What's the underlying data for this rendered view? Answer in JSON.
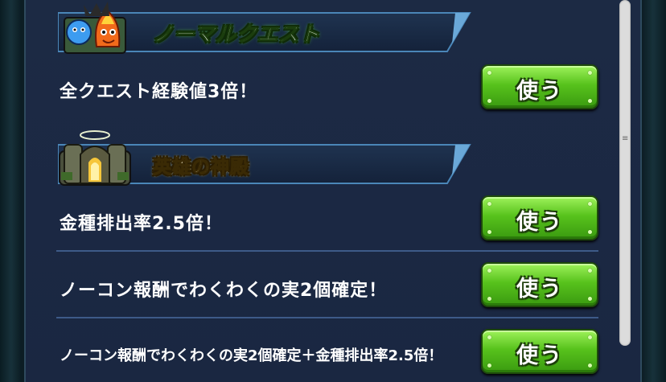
{
  "sections": [
    {
      "title": "ノーマルクエスト",
      "icon": "quest-monsters-icon",
      "rows": [
        {
          "text": "全クエスト経験値3倍！",
          "button_label": "使う"
        }
      ]
    },
    {
      "title": "英雄の神殿",
      "icon": "temple-icon",
      "rows": [
        {
          "text": "金種排出率2.5倍！",
          "button_label": "使う"
        },
        {
          "text": "ノーコン報酬でわくわくの実2個確定！",
          "button_label": "使う"
        },
        {
          "text": "ノーコン報酬でわくわくの実2個確定＋金種排出率2.5倍！",
          "button_label": "使う"
        }
      ]
    }
  ],
  "colors": {
    "panel": "#1c2a44",
    "button_green": "#57c21c",
    "divider": "#3d5a88"
  }
}
